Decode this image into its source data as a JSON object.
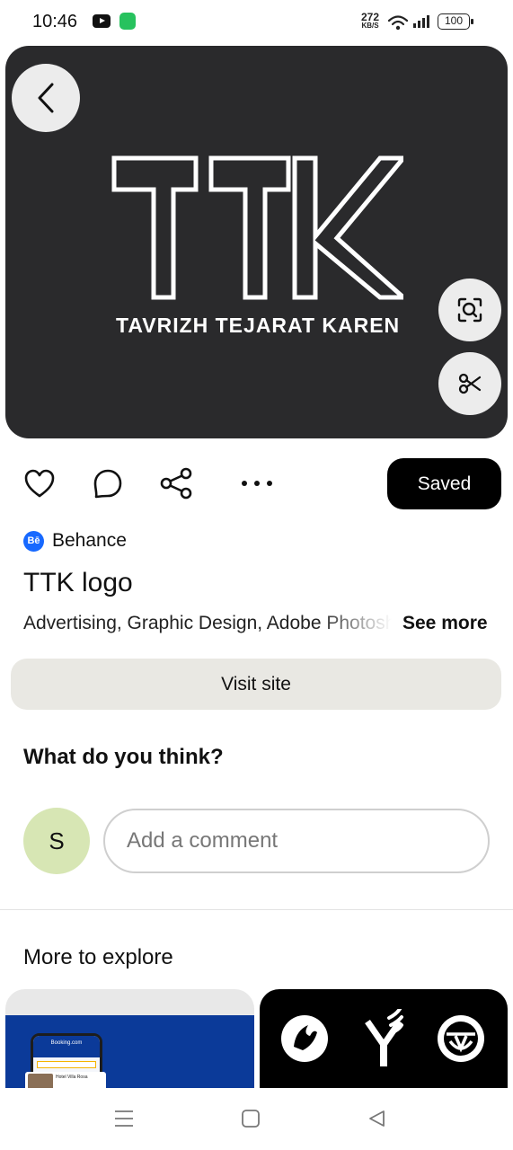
{
  "status_bar": {
    "time": "10:46",
    "app_badge": "",
    "net_speed_value": "272",
    "net_speed_unit": "KB/S",
    "battery": "100",
    "icons": [
      "youtube-icon",
      "app-notification-icon",
      "wifi-icon",
      "signal-icon",
      "battery-icon"
    ]
  },
  "hero": {
    "logo_letters": "TTK",
    "caption": "TAVRIZH TEJARAT KAREN",
    "background": "#2a2a2c",
    "icons": [
      "back-arrow-icon",
      "visual-search-icon",
      "scissors-icon"
    ]
  },
  "actions": {
    "icons": [
      "heart-icon",
      "comment-icon",
      "share-icon",
      "more-icon"
    ],
    "saved_label": "Saved"
  },
  "pin": {
    "source_icon": "Bē",
    "source_name": "Behance",
    "title": "TTK logo",
    "tags": "Advertising, Graphic Design, Adobe Photoshop",
    "see_more_label": "See more",
    "visit_label": "Visit site"
  },
  "comments": {
    "heading": "What do you think?",
    "avatar_initial": "S",
    "input_placeholder": "Add a comment"
  },
  "explore": {
    "heading": "More to explore",
    "cards": [
      {
        "label": "Booking.com",
        "hotel": "Hotel Villa Rosa"
      },
      {
        "label": ""
      }
    ]
  },
  "nav_bar": {
    "icons": [
      "menu-icon",
      "home-square-icon",
      "back-triangle-icon"
    ]
  },
  "colors": {
    "accent_black": "#000000",
    "visit_button": "#e9e8e3",
    "avatar_bg": "#d7e6b4",
    "behance_blue": "#1769ff"
  }
}
